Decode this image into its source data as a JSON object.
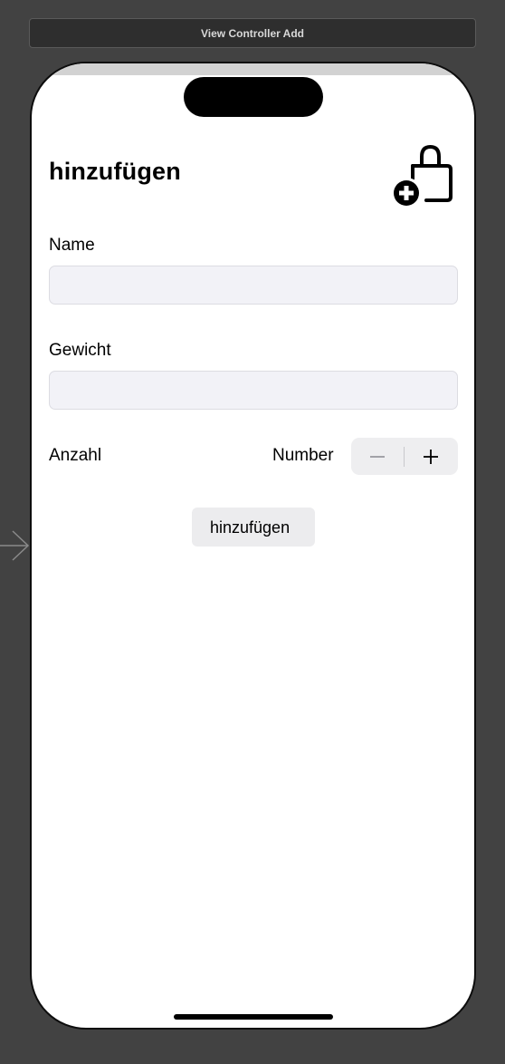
{
  "scene": {
    "title": "View Controller Add"
  },
  "screen": {
    "title": "hinzufügen",
    "name_label": "Name",
    "name_value": "",
    "weight_label": "Gewicht",
    "weight_value": "",
    "count_label": "Anzahl",
    "count_value_text": "Number",
    "add_button_label": "hinzufügen"
  },
  "colors": {
    "canvas": "#424242",
    "field_background": "#f2f2f7",
    "stepper_background": "#eeeef0"
  },
  "icons": {
    "title_icon": "bag-badge-plus-icon",
    "entry_arrow": "storyboard-entry-arrow-icon",
    "stepper_minus": "minus-icon",
    "stepper_plus": "plus-icon"
  }
}
